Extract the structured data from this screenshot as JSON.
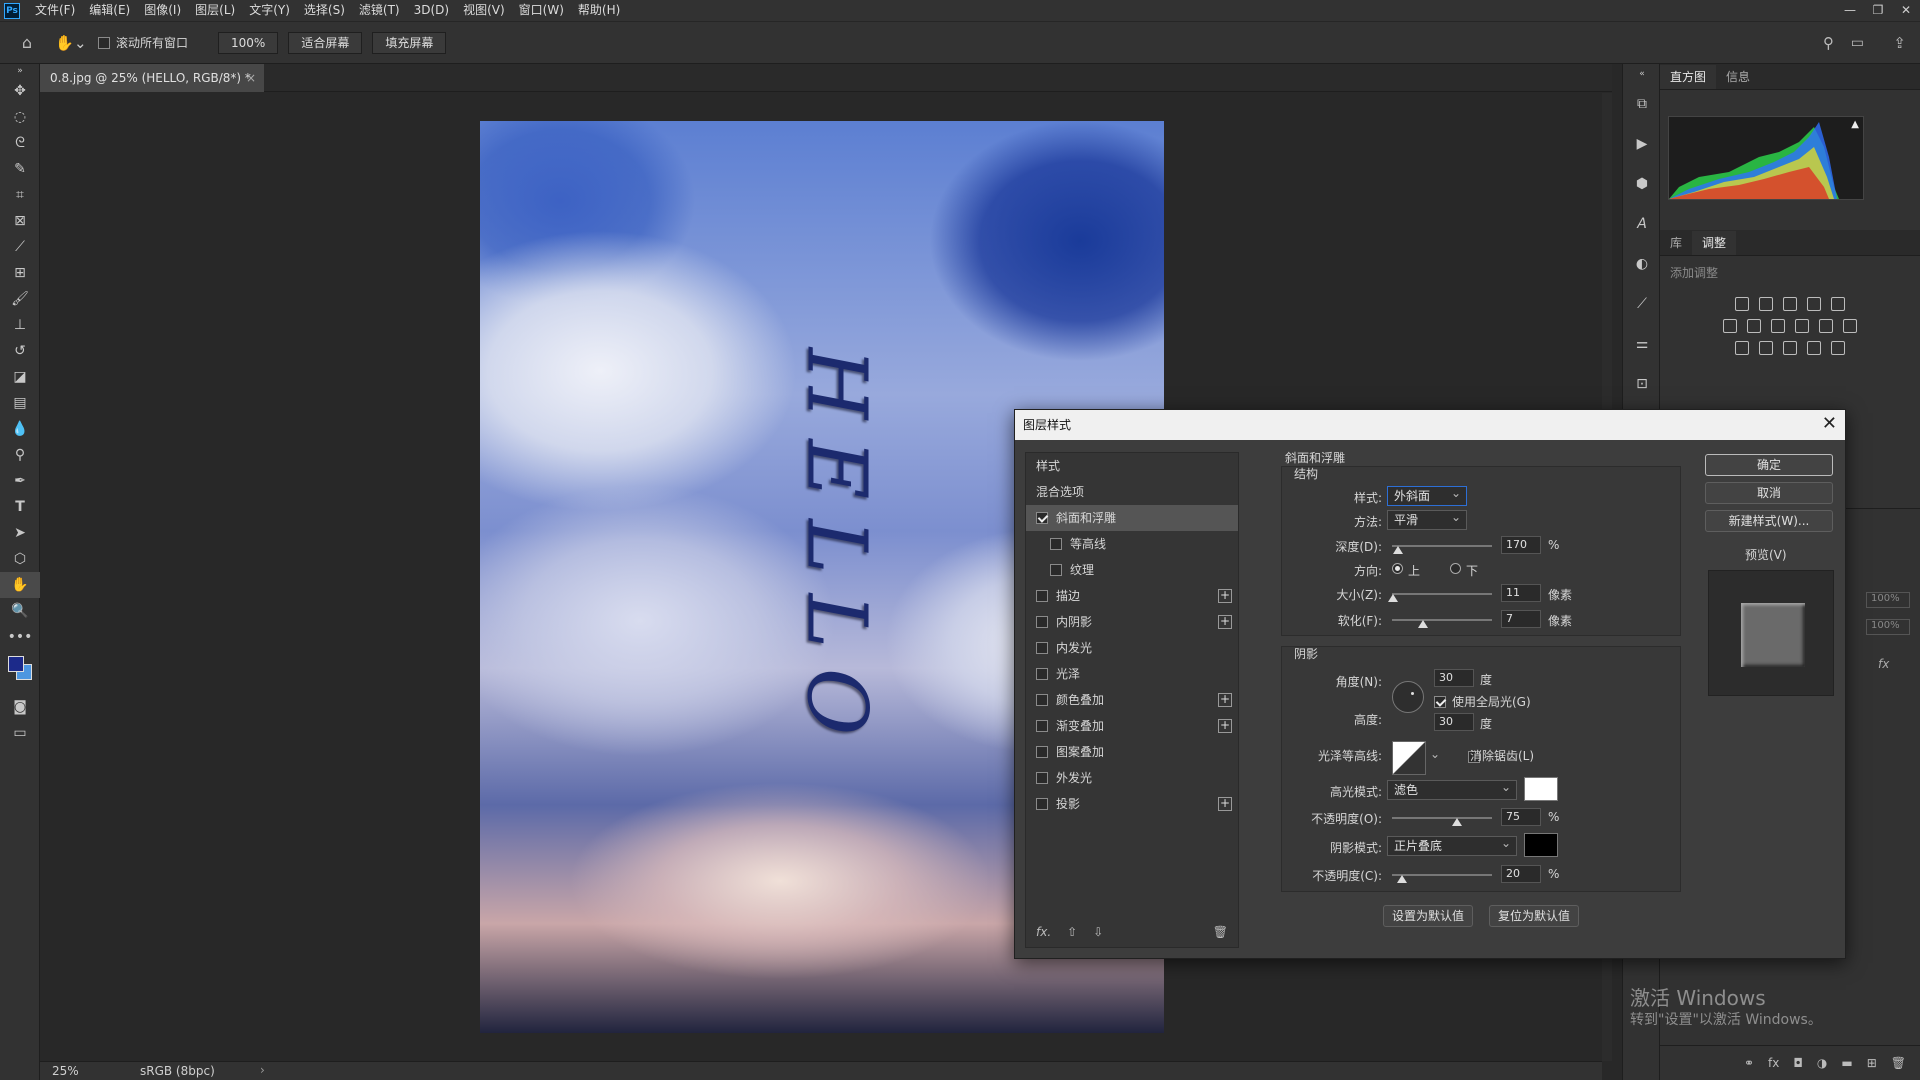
{
  "app": {
    "logo": "Ps"
  },
  "menu": [
    "文件(F)",
    "编辑(E)",
    "图像(I)",
    "图层(L)",
    "文字(Y)",
    "选择(S)",
    "滤镜(T)",
    "3D(D)",
    "视图(V)",
    "窗口(W)",
    "帮助(H)"
  ],
  "options": {
    "scroll_all": "滚动所有窗口",
    "zoom": "100%",
    "fit_screen": "适合屏幕",
    "fill_screen": "填充屏幕"
  },
  "document": {
    "tab": "0.8.jpg @ 25% (HELLO, RGB/8*) *",
    "text_layer": "HELLO"
  },
  "status": {
    "zoom": "25%",
    "profile": "sRGB (8bpc)"
  },
  "panels": {
    "top_tabs": [
      "直方图",
      "信息"
    ],
    "mid_tabs": [
      "库",
      "调整"
    ],
    "add_adjust": "添加调整",
    "opacity_values": [
      "100%",
      "100%"
    ]
  },
  "watermark": {
    "line1": "激活 Windows",
    "line2": "转到\"设置\"以激活 Windows。"
  },
  "dialog": {
    "title": "图层样式",
    "list_header": "样式",
    "blend": "混合选项",
    "items": [
      {
        "label": "斜面和浮雕",
        "checked": true,
        "selected": true,
        "sub": false,
        "plus": false
      },
      {
        "label": "等高线",
        "checked": false,
        "selected": false,
        "sub": true,
        "plus": false
      },
      {
        "label": "纹理",
        "checked": false,
        "selected": false,
        "sub": true,
        "plus": false
      },
      {
        "label": "描边",
        "checked": false,
        "selected": false,
        "sub": false,
        "plus": true
      },
      {
        "label": "内阴影",
        "checked": false,
        "selected": false,
        "sub": false,
        "plus": true
      },
      {
        "label": "内发光",
        "checked": false,
        "selected": false,
        "sub": false,
        "plus": false
      },
      {
        "label": "光泽",
        "checked": false,
        "selected": false,
        "sub": false,
        "plus": false
      },
      {
        "label": "颜色叠加",
        "checked": false,
        "selected": false,
        "sub": false,
        "plus": true
      },
      {
        "label": "渐变叠加",
        "checked": false,
        "selected": false,
        "sub": false,
        "plus": true
      },
      {
        "label": "图案叠加",
        "checked": false,
        "selected": false,
        "sub": false,
        "plus": false
      },
      {
        "label": "外发光",
        "checked": false,
        "selected": false,
        "sub": false,
        "plus": false
      },
      {
        "label": "投影",
        "checked": false,
        "selected": false,
        "sub": false,
        "plus": true
      }
    ],
    "fx": "fx.",
    "section_title": "斜面和浮雕",
    "structure": {
      "title": "结构",
      "style_label": "样式:",
      "style_value": "外斜面",
      "method_label": "方法:",
      "method_value": "平滑",
      "depth_label": "深度(D):",
      "depth_value": "170",
      "depth_unit": "%",
      "direction_label": "方向:",
      "dir_up": "上",
      "dir_down": "下",
      "size_label": "大小(Z):",
      "size_value": "11",
      "size_unit": "像素",
      "soften_label": "软化(F):",
      "soften_value": "7",
      "soften_unit": "像素"
    },
    "shading": {
      "title": "阴影",
      "angle_label": "角度(N):",
      "angle_value": "30",
      "angle_unit": "度",
      "global_light": "使用全局光(G)",
      "altitude_label": "高度:",
      "altitude_value": "30",
      "altitude_unit": "度",
      "gloss_label": "光泽等高线:",
      "antialias": "消除锯齿(L)",
      "highlight_label": "高光模式:",
      "highlight_value": "滤色",
      "hl_opacity_label": "不透明度(O):",
      "hl_opacity_value": "75",
      "hl_opacity_unit": "%",
      "shadow_label": "阴影模式:",
      "shadow_value": "正片叠底",
      "sh_opacity_label": "不透明度(C):",
      "sh_opacity_value": "20",
      "sh_opacity_unit": "%"
    },
    "set_default": "设置为默认值",
    "reset_default": "复位为默认值",
    "ok": "确定",
    "cancel": "取消",
    "new_style": "新建样式(W)...",
    "preview": "预览(V)"
  },
  "colors": {
    "highlight": "#ffffff",
    "shadow": "#000000",
    "foreground": "#1c2a8a"
  }
}
